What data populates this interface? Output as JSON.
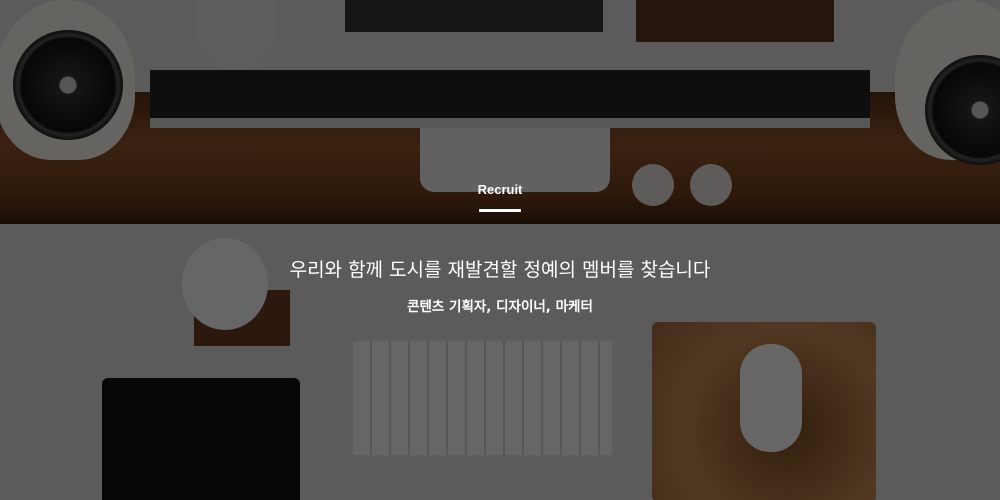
{
  "hero": {
    "section_label": "Recruit",
    "headline": "우리와 함께 도시를 재발견할 정예의 멤버를 찾습니다",
    "positions": "콘텐츠 기획자, 디자이너, 마케터"
  }
}
